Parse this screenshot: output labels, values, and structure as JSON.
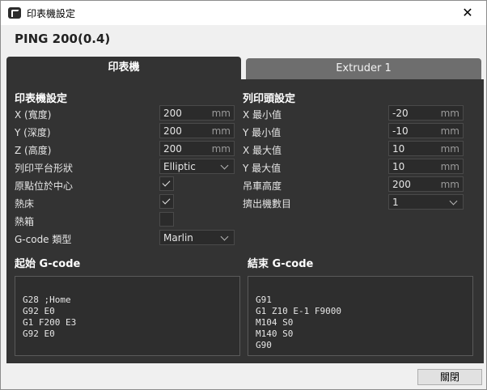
{
  "window": {
    "title": "印表機設定",
    "close_glyph": "✕"
  },
  "printer_name": "PING 200(0.4)",
  "tabs": [
    {
      "label": "印表機",
      "active": true
    },
    {
      "label": "Extruder 1",
      "active": false
    }
  ],
  "printer_settings": {
    "title": "印表機設定",
    "x_label": "X (寬度)",
    "x_value": "200",
    "x_unit": "mm",
    "y_label": "Y (深度)",
    "y_value": "200",
    "y_unit": "mm",
    "z_label": "Z (高度)",
    "z_value": "200",
    "z_unit": "mm",
    "build_plate_label": "列印平台形狀",
    "build_plate_value": "Elliptic",
    "origin_center_label": "原點位於中心",
    "origin_center_checked": true,
    "heated_bed_label": "熱床",
    "heated_bed_checked": true,
    "heated_volume_label": "熱箱",
    "heated_volume_checked": false,
    "gcode_flavor_label": "G-code 類型",
    "gcode_flavor_value": "Marlin"
  },
  "printhead_settings": {
    "title": "列印頭設定",
    "xmin_label": "X 最小值",
    "xmin_value": "-20",
    "xmin_unit": "mm",
    "ymin_label": "Y 最小值",
    "ymin_value": "-10",
    "ymin_unit": "mm",
    "xmax_label": "X 最大值",
    "xmax_value": "10",
    "xmax_unit": "mm",
    "ymax_label": "Y 最大值",
    "ymax_value": "10",
    "ymax_unit": "mm",
    "gantry_label": "吊車高度",
    "gantry_value": "200",
    "gantry_unit": "mm",
    "extruder_count_label": "擠出機數目",
    "extruder_count_value": "1"
  },
  "start_gcode": {
    "title": "起始 G-code",
    "text": "G28 ;Home\nG92 E0\nG1 F200 E3\nG92 E0"
  },
  "end_gcode": {
    "title": "結束 G-code",
    "text": "G91\nG1 Z10 E-1 F9000\nM104 S0\nM140 S0\nG90"
  },
  "footer": {
    "close_label": "關閉"
  },
  "colors": {
    "panel": "#333333",
    "inactive_tab": "#6e6e6e",
    "field_bg": "#2b2b2b"
  },
  "icons": {
    "app": "printer-app-icon",
    "close": "close-icon",
    "check": "checkmark-icon",
    "dropdown": "chevron-down-icon"
  }
}
